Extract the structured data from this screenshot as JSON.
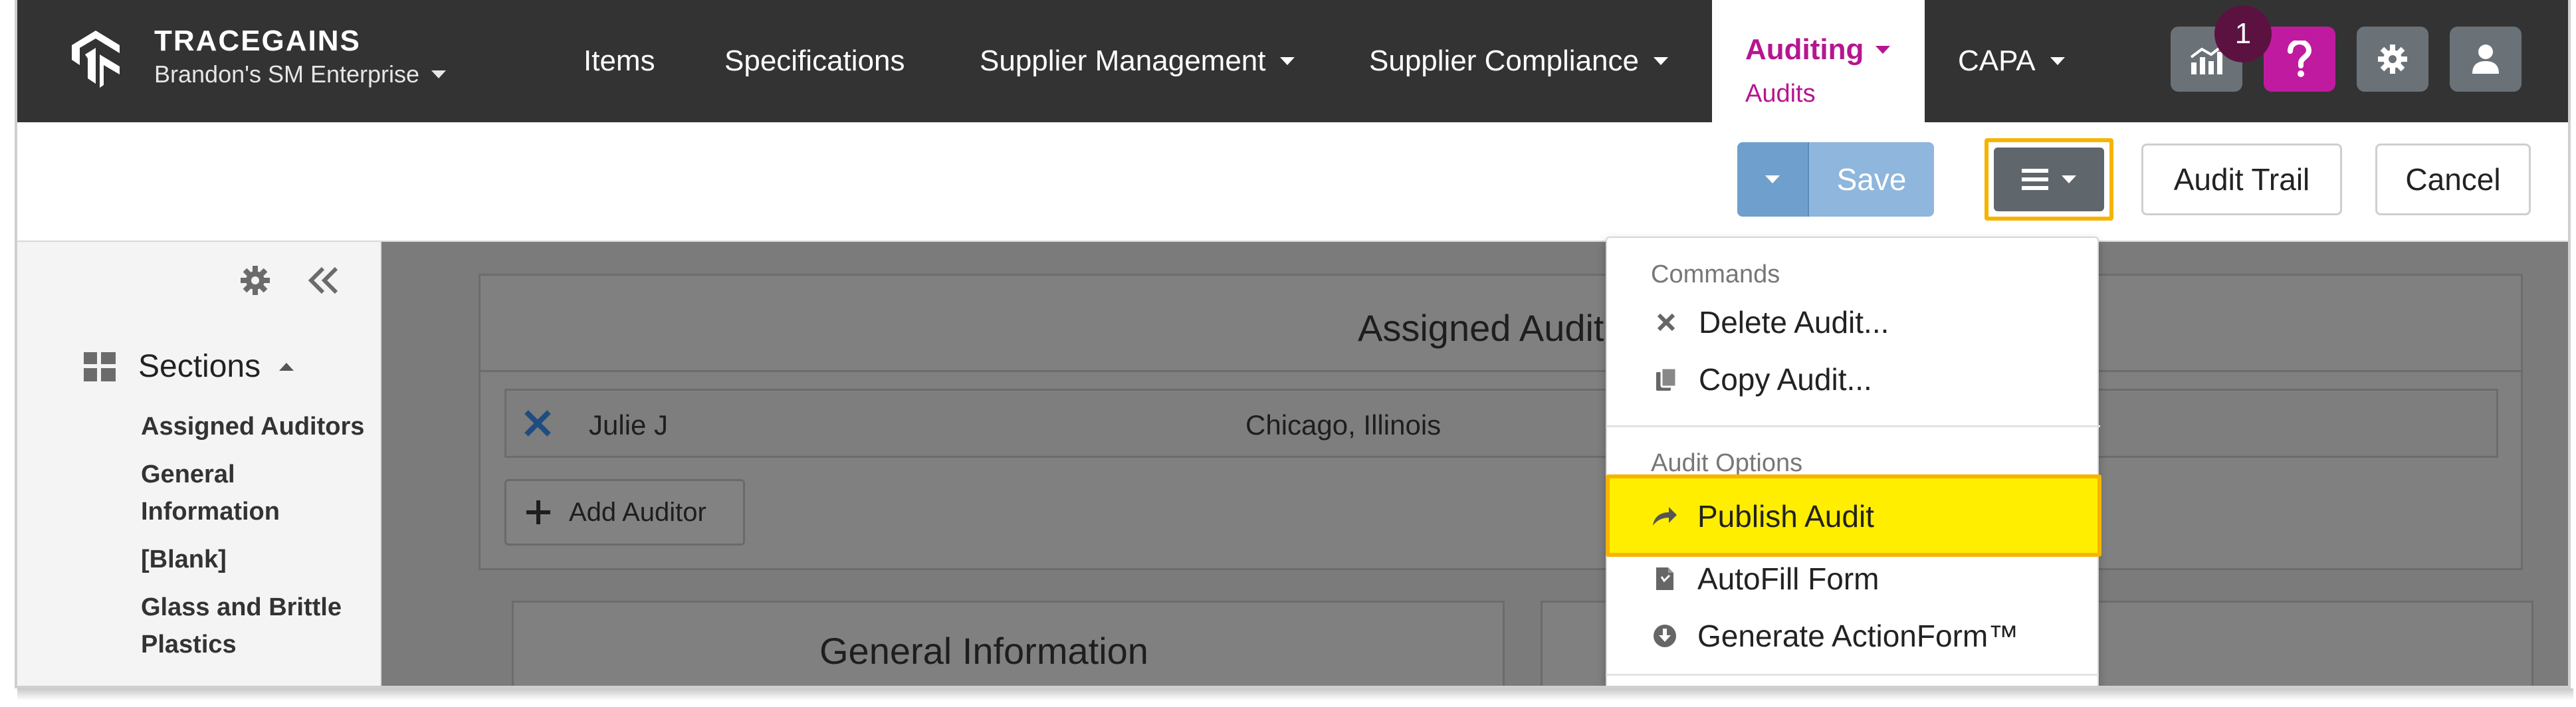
{
  "brand": {
    "name": "TRACEGAINS",
    "enterprise": "Brandon's SM Enterprise"
  },
  "nav": {
    "items": [
      {
        "label": "Items"
      },
      {
        "label": "Specifications"
      },
      {
        "label": "Supplier Management"
      },
      {
        "label": "Supplier Compliance"
      },
      {
        "label": "Auditing",
        "sub": "Audits",
        "active": true
      },
      {
        "label": "CAPA"
      }
    ],
    "notification_count": "1",
    "icons": [
      "analytics-icon",
      "help-icon",
      "gear-icon",
      "user-icon"
    ]
  },
  "toolbar": {
    "save_label": "Save",
    "audit_trail_label": "Audit Trail",
    "cancel_label": "Cancel"
  },
  "sidebar": {
    "sections_label": "Sections",
    "items": [
      {
        "label": "Assigned Auditors"
      },
      {
        "label": "General Information"
      },
      {
        "label": "[Blank]"
      },
      {
        "label": "Glass and Brittle Plastics"
      }
    ]
  },
  "main": {
    "assigned_title": "Assigned Audit",
    "auditor_name": "Julie J",
    "auditor_location": "Chicago, Illinois",
    "add_auditor_label": "Add Auditor",
    "general_info_title": "General Information"
  },
  "menu": {
    "commands_header": "Commands",
    "delete_label": "Delete Audit...",
    "copy_label": "Copy Audit...",
    "options_header": "Audit Options",
    "publish_label": "Publish Audit",
    "autofill_label": "AutoFill Form",
    "generate_label": "Generate ActionForm™"
  },
  "colors": {
    "nav_bg": "#333333",
    "active_accent": "#b5168f",
    "save_blue": "#8fb6dc",
    "highlight_yellow": "#ffee00",
    "highlight_border": "#f6b400"
  }
}
